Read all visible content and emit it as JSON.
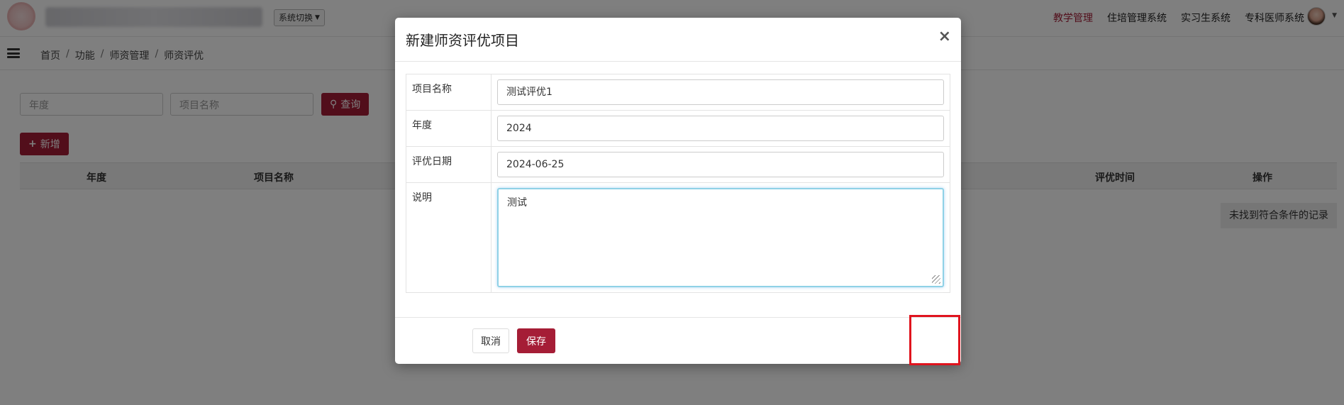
{
  "header": {
    "system_switch_label": "系统切换",
    "nav": [
      {
        "label": "教学管理",
        "active": true
      },
      {
        "label": "住培管理系统",
        "active": false
      },
      {
        "label": "实习生系统",
        "active": false
      },
      {
        "label": "专科医师系统",
        "active": false
      }
    ],
    "accent_color": "#a51d36"
  },
  "breadcrumb": [
    "首页",
    "功能",
    "师资管理",
    "师资评优"
  ],
  "filters": {
    "year_placeholder": "年度",
    "project_name_placeholder": "项目名称",
    "query_label": "查询"
  },
  "add_label": "新增",
  "table": {
    "columns": [
      "年度",
      "项目名称",
      "评优时间",
      "操作"
    ],
    "empty_text": "未找到符合条件的记录"
  },
  "modal": {
    "title": "新建师资评优项目",
    "close_symbol": "×",
    "fields": {
      "project_name": {
        "label": "项目名称",
        "value": "测试评优1"
      },
      "year": {
        "label": "年度",
        "value": "2024"
      },
      "date": {
        "label": "评优日期",
        "value": "2024-06-25"
      },
      "description": {
        "label": "说明",
        "value": "测试"
      }
    },
    "cancel_label": "取消",
    "save_label": "保存"
  }
}
